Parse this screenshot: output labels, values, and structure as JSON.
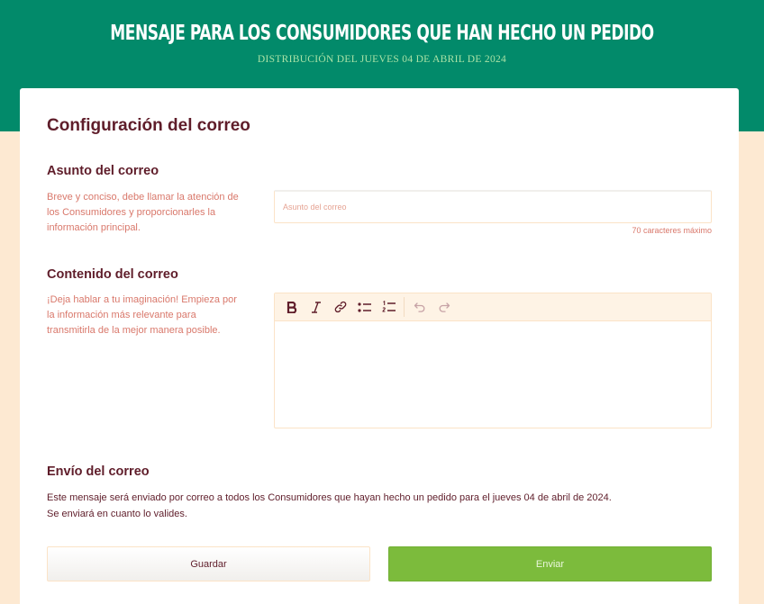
{
  "header": {
    "title": "MENSAJE PARA LOS CONSUMIDORES QUE HAN HECHO UN PEDIDO",
    "subtitle": "DISTRIBUCIÓN DEL JUEVES 04 DE ABRIL DE 2024"
  },
  "card": {
    "title": "Configuración del correo"
  },
  "subject": {
    "title": "Asunto del correo",
    "help": "Breve y conciso, debe llamar la atención de los Consumidores y proporcionarles la información principal.",
    "placeholder": "Asunto del correo",
    "value": "",
    "max_chars_label": "70 caracteres máximo"
  },
  "content": {
    "title": "Contenido del correo",
    "help": "¡Deja hablar a tu imaginación! Empieza por la información más relevante para transmitirla de la mejor manera posible.",
    "toolbar": {
      "bold": "bold-icon",
      "italic": "italic-icon",
      "link": "link-icon",
      "bullet_list": "bullet-list-icon",
      "ordered_list": "ordered-list-icon",
      "undo": "undo-icon",
      "redo": "redo-icon"
    }
  },
  "sending": {
    "title": "Envío del correo",
    "line1": "Este mensaje será enviado por correo a todos los Consumidores que hayan hecho un pedido para el jueves 04 de abril de 2024.",
    "line2": "Se enviará en cuanto lo valides."
  },
  "actions": {
    "save_label": "Guardar",
    "send_label": "Enviar"
  },
  "colors": {
    "header_green": "#028a6a",
    "page_background": "#fde9d2",
    "title_maroon": "#5f1d2a",
    "help_salmon": "#d9786b",
    "send_green": "#7cbb3c"
  }
}
